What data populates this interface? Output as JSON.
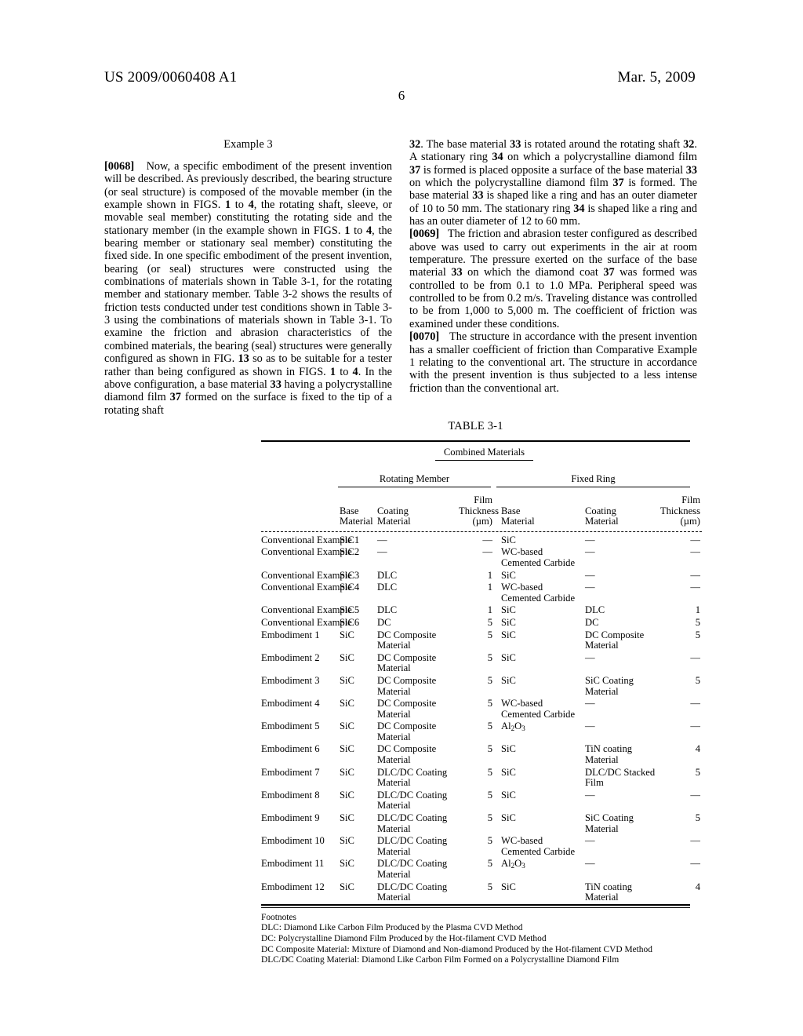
{
  "header": {
    "publication_number": "US 2009/0060408 A1",
    "date": "Mar. 5, 2009",
    "page_number": "6"
  },
  "left_column": {
    "section_heading": "Example 3",
    "paragraphs": [
      {
        "number": "[0068]",
        "text": "Now, a specific embodiment of the present invention will be described. As previously described, the bearing structure (or seal structure) is composed of the movable member (in the example shown in FIGS. 1 to 4, the rotating shaft, sleeve, or movable seal member) constituting the rotating side and the stationary member (in the example shown in FIGS. 1 to 4, the bearing member or stationary seal member) constituting the fixed side. In one specific embodiment of the present invention, bearing (or seal) structures were constructed using the combinations of materials shown in Table 3-1, for the rotating member and stationary member. Table 3-2 shows the results of friction tests conducted under test conditions shown in Table 3-3 using the combinations of materials shown in Table 3-1. To examine the friction and abrasion characteristics of the combined materials, the bearing (seal) structures were generally configured as shown in FIG. 13 so as to be suitable for a tester rather than being configured as shown in FIGS. 1 to 4. In the above configuration, a base material 33 having a polycrystalline diamond film 37 formed on the surface is fixed to the tip of a rotating shaft"
      }
    ]
  },
  "right_column": {
    "paragraphs": [
      {
        "number": "",
        "text": "32. The base material 33 is rotated around the rotating shaft 32. A stationary ring 34 on which a polycrystalline diamond film 37 is formed is placed opposite a surface of the base material 33 on which the polycrystalline diamond film 37 is formed. The base material 33 is shaped like a ring and has an outer diameter of 10 to 50 mm. The stationary ring 34 is shaped like a ring and has an outer diameter of 12 to 60 mm."
      },
      {
        "number": "[0069]",
        "text": "The friction and abrasion tester configured as described above was used to carry out experiments in the air at room temperature. The pressure exerted on the surface of the base material 33 on which the diamond coat 37 was formed was controlled to be from 0.1 to 1.0 MPa. Peripheral speed was controlled to be from 0.2 m/s. Traveling distance was controlled to be from 1,000 to 5,000 m. The coefficient of friction was examined under these conditions."
      },
      {
        "number": "[0070]",
        "text": "The structure in accordance with the present invention has a smaller coefficient of friction than Comparative Example 1 relating to the conventional art. The structure in accordance with the present invention is thus subjected to a less intense friction than the conventional art."
      }
    ]
  },
  "table": {
    "caption": "TABLE 3-1",
    "group_top": "Combined Materials",
    "group_left": "Rotating Member",
    "group_right": "Fixed Ring",
    "columns": [
      {
        "line1": "",
        "line2": ""
      },
      {
        "line1": "Base",
        "line2": "Material"
      },
      {
        "line1": "Coating",
        "line2": "Material"
      },
      {
        "line1": "Film Thickness",
        "line2": "(µm)"
      },
      {
        "line1": "Base",
        "line2": "Material"
      },
      {
        "line1": "Coating",
        "line2": "Material"
      },
      {
        "line1": "Film Thickness",
        "line2": "(µm)"
      }
    ],
    "header_cells": {
      "film": "Film",
      "thickness": "Thickness",
      "unit": "(µm)",
      "base": "Base",
      "material": "Material",
      "coating": "Coating"
    },
    "rows": [
      {
        "label": "Conventional Example 1",
        "bm1": "SiC",
        "cm1": "—",
        "ft1": "—",
        "bm2": "SiC",
        "cm2": "—",
        "ft2": "—"
      },
      {
        "label": "Conventional Example 2",
        "bm1": "SiC",
        "cm1": "—",
        "ft1": "—",
        "bm2": "WC-based Cemented Carbide",
        "cm2": "—",
        "ft2": "—"
      },
      {
        "label": "Conventional Example 3",
        "bm1": "SiC",
        "cm1": "DLC",
        "ft1": "1",
        "bm2": "SiC",
        "cm2": "—",
        "ft2": "—"
      },
      {
        "label": "Conventional Example 4",
        "bm1": "SiC",
        "cm1": "DLC",
        "ft1": "1",
        "bm2": "WC-based Cemented Carbide",
        "cm2": "—",
        "ft2": "—"
      },
      {
        "label": "Conventional Example 5",
        "bm1": "SiC",
        "cm1": "DLC",
        "ft1": "1",
        "bm2": "SiC",
        "cm2": "DLC",
        "ft2": "1"
      },
      {
        "label": "Conventional Example 6",
        "bm1": "SiC",
        "cm1": "DC",
        "ft1": "5",
        "bm2": "SiC",
        "cm2": "DC",
        "ft2": "5"
      },
      {
        "label": "Embodiment 1",
        "bm1": "SiC",
        "cm1": "DC Composite Material",
        "ft1": "5",
        "bm2": "SiC",
        "cm2": "DC Composite Material",
        "ft2": "5"
      },
      {
        "label": "Embodiment 2",
        "bm1": "SiC",
        "cm1": "DC Composite Material",
        "ft1": "5",
        "bm2": "SiC",
        "cm2": "—",
        "ft2": "—"
      },
      {
        "label": "Embodiment 3",
        "bm1": "SiC",
        "cm1": "DC Composite Material",
        "ft1": "5",
        "bm2": "SiC",
        "cm2": "SiC Coating Material",
        "ft2": "5"
      },
      {
        "label": "Embodiment 4",
        "bm1": "SiC",
        "cm1": "DC Composite Material",
        "ft1": "5",
        "bm2": "WC-based Cemented Carbide",
        "cm2": "—",
        "ft2": "—"
      },
      {
        "label": "Embodiment 5",
        "bm1": "SiC",
        "cm1": "DC Composite Material",
        "ft1": "5",
        "bm2": "Al2O3",
        "cm2": "—",
        "ft2": "—"
      },
      {
        "label": "Embodiment 6",
        "bm1": "SiC",
        "cm1": "DC Composite Material",
        "ft1": "5",
        "bm2": "SiC",
        "cm2": "TiN coating Material",
        "ft2": "4"
      },
      {
        "label": "Embodiment 7",
        "bm1": "SiC",
        "cm1": "DLC/DC Coating Material",
        "ft1": "5",
        "bm2": "SiC",
        "cm2": "DLC/DC Stacked Film",
        "ft2": "5"
      },
      {
        "label": "Embodiment 8",
        "bm1": "SiC",
        "cm1": "DLC/DC Coating Material",
        "ft1": "5",
        "bm2": "SiC",
        "cm2": "—",
        "ft2": "—"
      },
      {
        "label": "Embodiment 9",
        "bm1": "SiC",
        "cm1": "DLC/DC Coating Material",
        "ft1": "5",
        "bm2": "SiC",
        "cm2": "SiC Coating Material",
        "ft2": "5"
      },
      {
        "label": "Embodiment 10",
        "bm1": "SiC",
        "cm1": "DLC/DC Coating Material",
        "ft1": "5",
        "bm2": "WC-based Cemented Carbide",
        "cm2": "—",
        "ft2": "—"
      },
      {
        "label": "Embodiment 11",
        "bm1": "SiC",
        "cm1": "DLC/DC Coating Material",
        "ft1": "5",
        "bm2": "Al2O3",
        "cm2": "—",
        "ft2": "—"
      },
      {
        "label": "Embodiment 12",
        "bm1": "SiC",
        "cm1": "DLC/DC Coating Material",
        "ft1": "5",
        "bm2": "SiC",
        "cm2": "TiN coating Material",
        "ft2": "4"
      }
    ],
    "footnotes_title": "Footnotes",
    "footnotes": [
      "DLC: Diamond Like Carbon Film Produced by the Plasma CVD Method",
      "DC: Polycrystalline Diamond Film Produced by the Hot-filament CVD Method",
      "DC Composite Material: Mixture of Diamond and Non-diamond Produced by the Hot-filament CVD Method",
      "DLC/DC Coating Material: Diamond Like Carbon Film Formed on a Polycrystalline Diamond Film"
    ]
  }
}
